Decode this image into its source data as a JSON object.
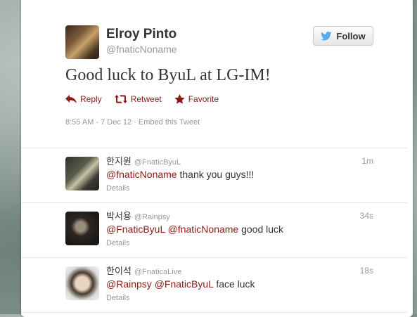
{
  "tweet": {
    "author_name": "Elroy Pinto",
    "author_handle": "@fnaticNoname",
    "follow_label": "Follow",
    "text": "Good luck to ByuL at LG-IM!",
    "actions": {
      "reply": "Reply",
      "retweet": "Retweet",
      "favorite": "Favorite"
    },
    "meta": "8:55 AM - 7 Dec 12 · Embed this Tweet"
  },
  "replies": [
    {
      "name": "한지원",
      "handle": "@FnaticByuL",
      "time": "1m",
      "mentions": [
        "@fnaticNoname"
      ],
      "text": "thank you guys!!!",
      "details": "Details"
    },
    {
      "name": "박서용",
      "handle": "@Rainpsy",
      "time": "34s",
      "mentions": [
        "@FnaticByuL",
        "@fnaticNoname"
      ],
      "text": "good luck",
      "details": "Details"
    },
    {
      "name": "한이석",
      "handle": "@FnaticaLive",
      "time": "18s",
      "mentions": [
        "@Rainpsy",
        "@FnaticByuL"
      ],
      "text": "face luck",
      "details": "Details"
    }
  ],
  "colors": {
    "accent": "#8b1b14",
    "muted": "#999999",
    "text": "#333333",
    "twitter_blue": "#55acee"
  }
}
